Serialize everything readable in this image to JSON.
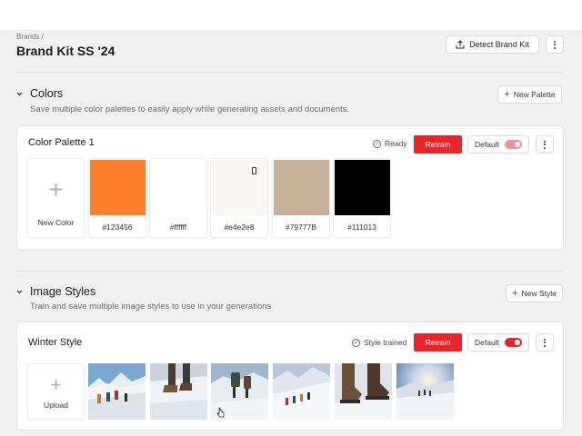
{
  "header": {
    "breadcrumb": "Brands /",
    "title": "Brand Kit SS '24",
    "detect_label": "Detect Brand Kit"
  },
  "colors": {
    "title": "Colors",
    "description": "Save multiple color palettes to easily apply while generating assets and documents.",
    "new_label": "New Palette",
    "palette": {
      "name": "Color Palette 1",
      "status": "Ready",
      "retrain_label": "Retrain",
      "default_label": "Default",
      "new_color_label": "New Color",
      "swatches": [
        {
          "hex_label": "#123456",
          "color": "#ff7f2a"
        },
        {
          "hex_label": "#ffffff",
          "color": "#ffffff"
        },
        {
          "hex_label": "#e4e2e8",
          "color": "#fbf7f6"
        },
        {
          "hex_label": "#79777B",
          "color": "#c8b19a"
        },
        {
          "hex_label": "#111013",
          "color": "#000000"
        }
      ]
    }
  },
  "image_styles": {
    "title": "Image Styles",
    "description": "Train and save multiple image styles to use in your generations",
    "new_label": "New Style",
    "style": {
      "name": "Winter Style",
      "status": "Style trained",
      "retrain_label": "Retrain",
      "default_label": "Default",
      "upload_label": "Upload",
      "images": [
        "hikers-group",
        "boots-snow",
        "backpackers",
        "hikers-slope",
        "boots-closeup",
        "sunrise-trail"
      ]
    }
  },
  "theme": {
    "accent": "#e8232a"
  }
}
